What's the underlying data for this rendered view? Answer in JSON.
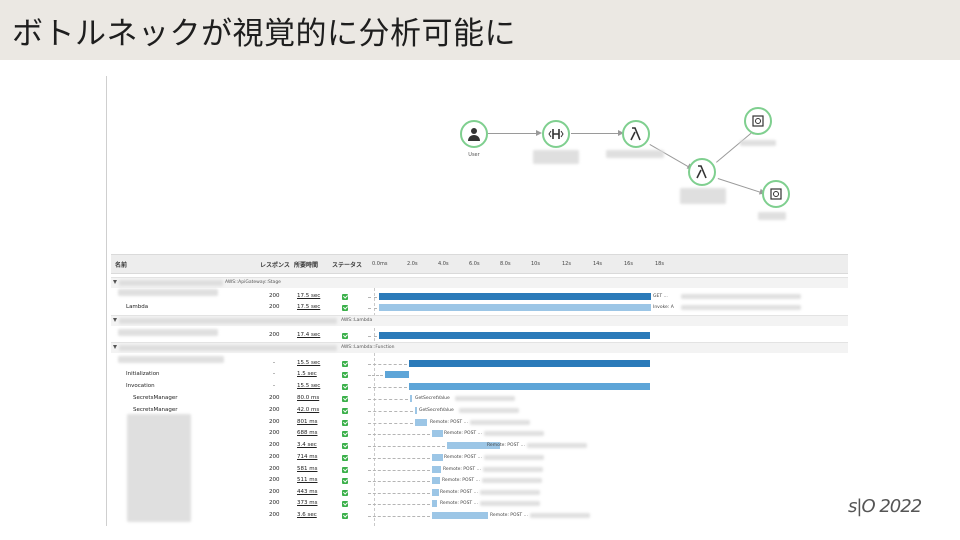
{
  "slide": {
    "title": "ボトルネックが視覚的に分析可能に",
    "logo_text": "s|O 2022"
  },
  "service_map": {
    "nodes": [
      {
        "name": "user",
        "label": "User",
        "icon": "user-icon"
      },
      {
        "name": "api-gateway",
        "label": "",
        "icon": "api-gateway-icon"
      },
      {
        "name": "lambda-1",
        "label": "",
        "icon": "lambda-icon"
      },
      {
        "name": "lambda-2",
        "label": "",
        "icon": "lambda-icon"
      },
      {
        "name": "remote-1",
        "label": "",
        "icon": "remote-service-icon"
      },
      {
        "name": "remote-2",
        "label": "",
        "icon": "remote-service-icon"
      }
    ],
    "accent_color": "#7fcf8f"
  },
  "trace_table": {
    "headers": {
      "name": "名前",
      "response": "レスポンス",
      "duration": "所要時間",
      "status": "ステータス"
    },
    "timeline_ticks": [
      "0.0ms",
      "2.0s",
      "4.0s",
      "6.0s",
      "8.0s",
      "10s",
      "12s",
      "14s",
      "16s",
      "18s"
    ],
    "groups": [
      {
        "label": "AWS::ApiGateway::Stage"
      },
      {
        "label": "AWS::Lambda"
      },
      {
        "label": "AWS::Lambda::Function"
      }
    ],
    "rows": [
      {
        "name": "",
        "response": "200",
        "duration": "17.5 sec",
        "bar_label": "GET ..."
      },
      {
        "name": "Lambda",
        "response": "200",
        "duration": "17.5 sec",
        "bar_label": "Invoke: A"
      },
      {
        "name": "",
        "response": "200",
        "duration": "17.4 sec",
        "bar_label": ""
      },
      {
        "name": "",
        "response": "-",
        "duration": "15.5 sec",
        "bar_label": ""
      },
      {
        "name": "Initialization",
        "response": "-",
        "duration": "1.5 sec",
        "bar_label": ""
      },
      {
        "name": "Invocation",
        "response": "-",
        "duration": "15.5 sec",
        "bar_label": ""
      },
      {
        "name": "SecretsManager",
        "response": "200",
        "duration": "80.0 ms",
        "bar_label": "GetSecretValue"
      },
      {
        "name": "SecretsManager",
        "response": "200",
        "duration": "42.0 ms",
        "bar_label": "GetSecretValue"
      },
      {
        "name": "",
        "response": "200",
        "duration": "801 ms",
        "bar_label": "Remote: POST ..."
      },
      {
        "name": "",
        "response": "200",
        "duration": "688 ms",
        "bar_label": "Remote: POST ..."
      },
      {
        "name": "",
        "response": "200",
        "duration": "3.4 sec",
        "bar_label": "Remote: POST ..."
      },
      {
        "name": "",
        "response": "200",
        "duration": "714 ms",
        "bar_label": "Remote: POST ..."
      },
      {
        "name": "",
        "response": "200",
        "duration": "581 ms",
        "bar_label": "Remote: POST ..."
      },
      {
        "name": "",
        "response": "200",
        "duration": "511 ms",
        "bar_label": "Remote: POST ..."
      },
      {
        "name": "",
        "response": "200",
        "duration": "443 ms",
        "bar_label": "Remote: POST ..."
      },
      {
        "name": "",
        "response": "200",
        "duration": "373 ms",
        "bar_label": "Remote: POST ..."
      },
      {
        "name": "",
        "response": "200",
        "duration": "3.6 sec",
        "bar_label": "Remote: POST ..."
      }
    ],
    "bar_colors": {
      "dark": "#2a7ab9",
      "light": "#9cc6e6",
      "status_ok": "#3bb04a"
    }
  }
}
